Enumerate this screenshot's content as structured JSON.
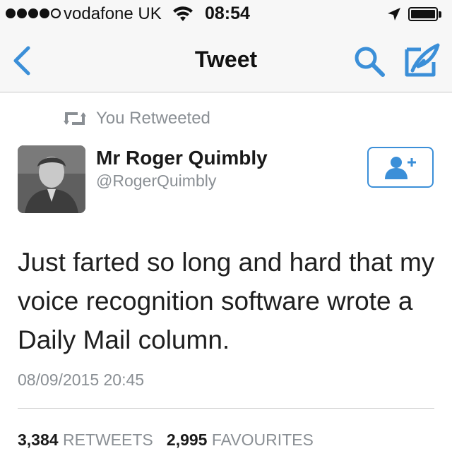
{
  "status_bar": {
    "carrier": "vodafone UK",
    "time": "08:54",
    "signal_bars_filled": 4,
    "signal_bars_total": 5,
    "battery_level": 0.9
  },
  "nav": {
    "title": "Tweet",
    "back_icon": "chevron-left-icon",
    "search_icon": "search-icon",
    "compose_icon": "compose-icon",
    "accent_color": "#3b8fd8"
  },
  "tweet": {
    "retweet_label": "You Retweeted",
    "author_name": "Mr Roger Quimbly",
    "author_handle": "@RogerQuimbly",
    "text": "Just farted so long and hard that my voice recognition software wrote a Daily Mail column.",
    "timestamp": "08/09/2015 20:45",
    "retweets_count": "3,384",
    "retweets_label": "RETWEETS",
    "favourites_count": "2,995",
    "favourites_label": "FAVOURITES"
  }
}
